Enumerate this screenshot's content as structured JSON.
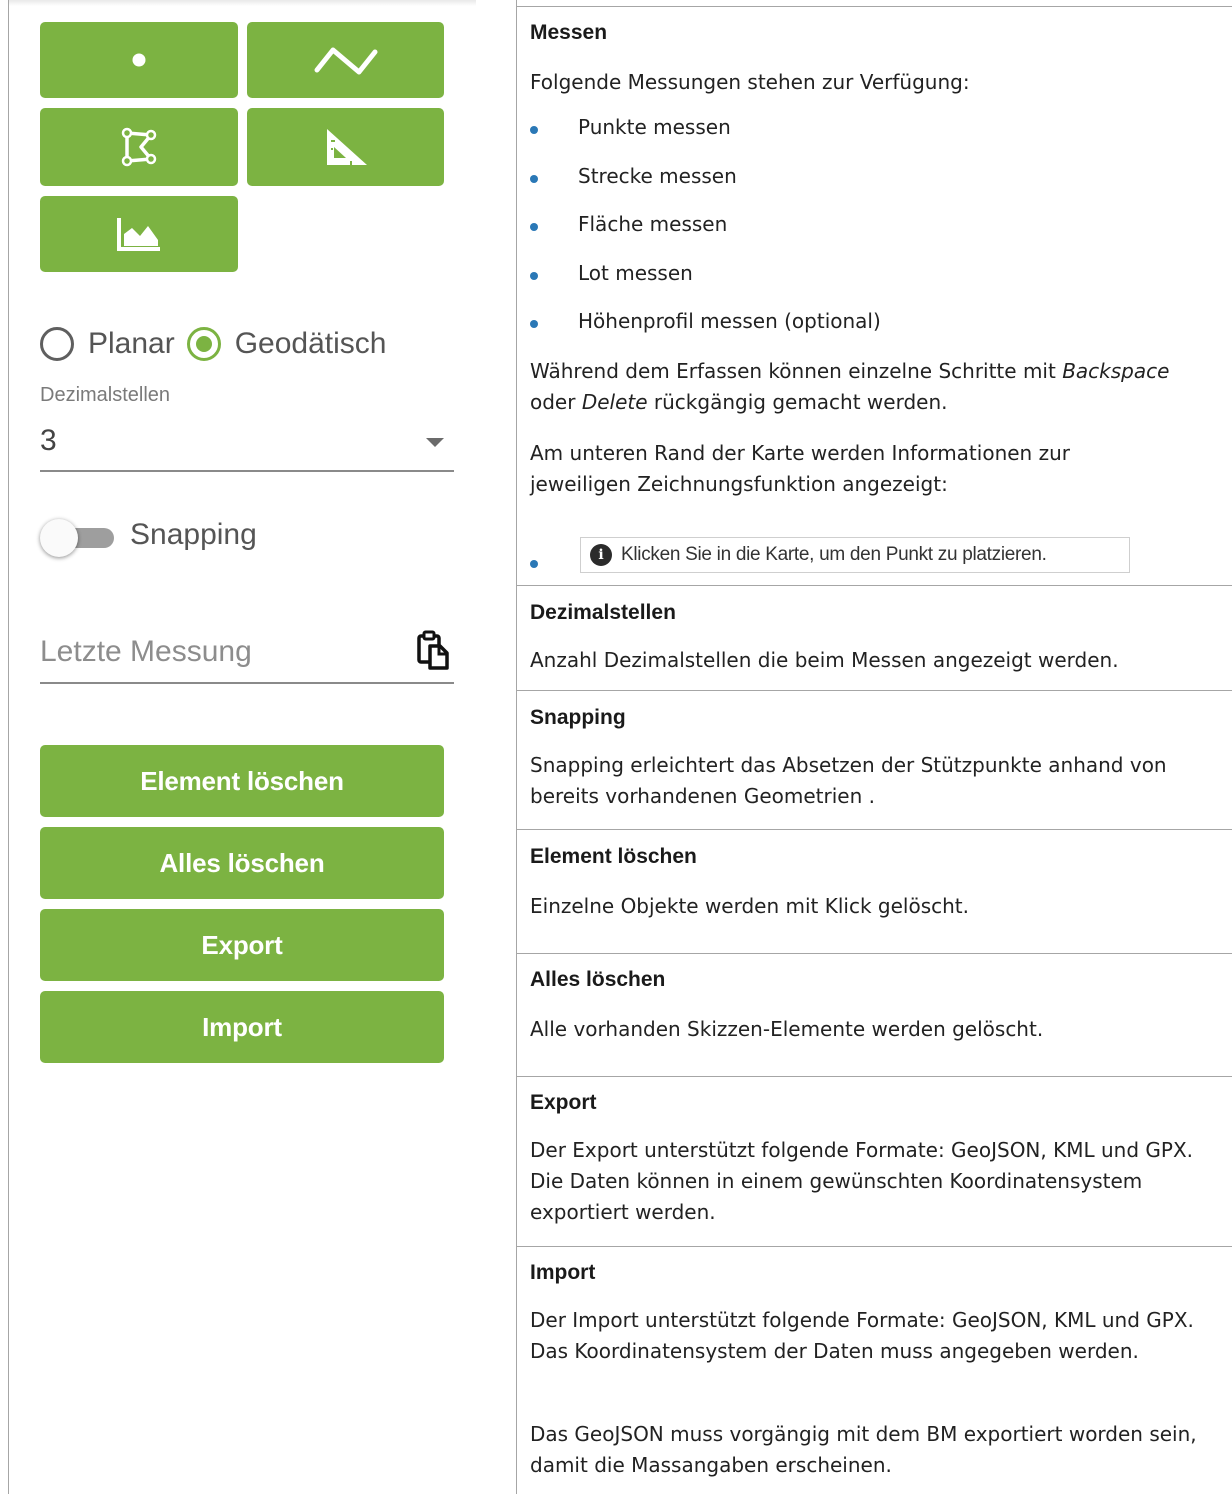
{
  "left_panel": {
    "tool_buttons": [
      {
        "icon": "point-icon"
      },
      {
        "icon": "line-icon"
      },
      {
        "icon": "polygon-icon"
      },
      {
        "icon": "set-square-icon"
      },
      {
        "icon": "elevation-profile-icon"
      }
    ],
    "radios": {
      "planar_label": "Planar",
      "geodetic_label": "Geodätisch",
      "selected": "Geodätisch"
    },
    "decimals": {
      "caption": "Dezimalstellen",
      "value": "3"
    },
    "snapping": {
      "label": "Snapping",
      "enabled": false
    },
    "last_measurement": {
      "placeholder": "Letzte Messung",
      "copy_icon": "clipboard-icon"
    },
    "buttons": {
      "delete_element": "Element löschen",
      "delete_all": "Alles löschen",
      "export": "Export",
      "import": "Import"
    }
  },
  "help": {
    "messen": {
      "title": "Messen",
      "intro": "Folgende Messungen stehen zur Verfügung:",
      "items": [
        "Punkte messen",
        "Strecke messen",
        "Fläche messen",
        "Lot messen",
        "Höhenprofil messen (optional)"
      ],
      "undo_pre": "Während dem Erfassen können einzelne Schritte mit ",
      "undo_key1": "Backspace",
      "undo_mid": "oder ",
      "undo_key2": "Delete",
      "undo_post": " rückgängig gemacht werden.",
      "info_text": "Am unteren Rand der Karte werden Informationen zur jeweiligen Zeichnungsfunktion angezeigt:",
      "hint": "Klicken Sie in die Karte, um den Punkt zu platzieren."
    },
    "dezimalstellen": {
      "title": "Dezimalstellen",
      "text": "Anzahl Dezimalstellen die beim Messen angezeigt werden."
    },
    "snapping": {
      "title": "Snapping",
      "text": "Snapping erleichtert das Absetzen der Stützpunkte anhand von bereits vorhandenen Geometrien ."
    },
    "element_loeschen": {
      "title": "Element löschen",
      "text": "Einzelne Objekte werden mit Klick gelöscht."
    },
    "alles_loeschen": {
      "title": "Alles löschen",
      "text": "Alle vorhanden Skizzen-Elemente werden gelöscht."
    },
    "export": {
      "title": "Export",
      "text": "Der Export unterstützt folgende Formate: GeoJSON, KML und GPX. Die Daten können in einem gewünschten Koordinatensystem exportiert werden."
    },
    "import": {
      "title": "Import",
      "text": "Der Import unterstützt folgende Formate: GeoJSON, KML und GPX. Das Koordinatensystem der Daten muss angegeben werden.",
      "text2": "Das GeoJSON muss vorgängig mit dem BM exportiert worden sein, damit die Massangaben erscheinen."
    }
  },
  "colors": {
    "accent_green": "#7cb342",
    "bullet_blue": "#2a78b6",
    "grid_line": "#a6a6a6"
  }
}
